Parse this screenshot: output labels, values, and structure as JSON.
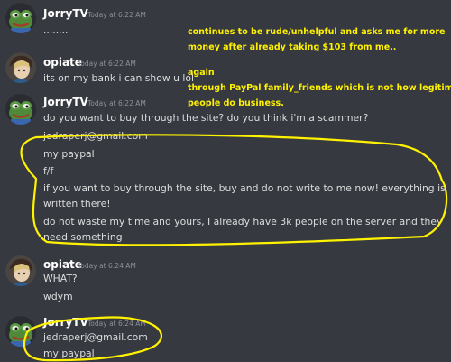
{
  "colors": {
    "background": "#36393f",
    "username": "#ffffff",
    "timestamp": "#8e9297",
    "message_text": "#dcddde",
    "annotation": "#fff200"
  },
  "messages": [
    {
      "author": "JorryTV",
      "timestamp": "Today at 6:22 AM",
      "avatar_icon": "pepe-frog-icon",
      "lines": [
        "........"
      ]
    },
    {
      "author": "opiate",
      "timestamp": "Today at 6:22 AM",
      "avatar_icon": "anime-character-icon",
      "lines": [
        "its on my bank i can show u lol"
      ]
    },
    {
      "author": "JorryTV",
      "timestamp": "Today at 6:22 AM",
      "avatar_icon": "pepe-frog-icon",
      "lines": [
        "do you want to buy through the site? do you think i'm a scammer?",
        "jedraperj@gmail.com",
        "my paypal",
        "f/f",
        "if you want to buy through the site, buy and do not write to me now! everything is",
        "written there!",
        "do not waste my time and yours, I already have 3k people on the server and they",
        "need something"
      ]
    },
    {
      "author": "opiate",
      "timestamp": "Today at 6:24 AM",
      "avatar_icon": "anime-character-icon",
      "lines": [
        "WHAT?",
        "wdym"
      ]
    },
    {
      "author": "JorryTV",
      "timestamp": "Today at 6:24 AM",
      "avatar_icon": "pepe-frog-icon",
      "lines": [
        "jedraperj@gmail.com",
        "my paypal"
      ]
    }
  ],
  "annotations": {
    "note_1": [
      "continues to be rude/unhelpful and asks me for more",
      "money after already taking $103 from me.."
    ],
    "note_2": [
      "again",
      "through PayPal family_friends which is not how legitimate",
      "people do business."
    ]
  }
}
